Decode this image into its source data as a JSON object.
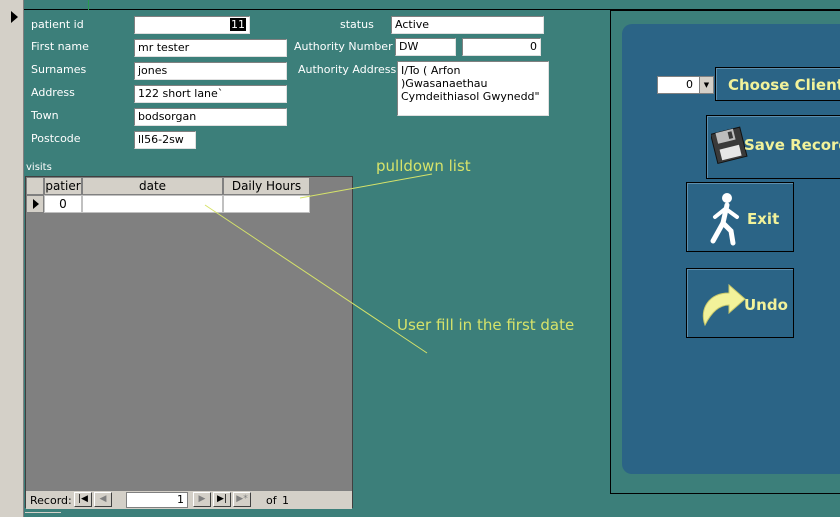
{
  "form": {
    "patient_id_label": "patient id",
    "patient_id_value": "11",
    "first_name_label": "First name",
    "first_name_value": "mr tester",
    "surnames_label": "Surnames",
    "surnames_value": "jones",
    "address_label": "Address",
    "address_value": "122 short lane`",
    "town_label": "Town",
    "town_value": "bodsorgan",
    "postcode_label": "Postcode",
    "postcode_value": "ll56-2sw",
    "status_label": "status",
    "status_value": "Active",
    "authority_number_label": "Authority Number",
    "authority_code_value": "DW",
    "authority_number_value": "0",
    "authority_address_label": "Authority Address1",
    "authority_address_line1": "I/To ( Arfon )Gwasanaethau",
    "authority_address_line2": "Cymdeithiasol Gwynedd\""
  },
  "visits": {
    "label": "visits",
    "columns": [
      "patier",
      "date",
      "Daily Hours"
    ],
    "rows": [
      {
        "patient": "0",
        "date": "",
        "daily_hours": ""
      }
    ],
    "nav": {
      "record_label": "Record:",
      "current": "1",
      "of_label": "of",
      "total": "1",
      "first_icon": "first-record-icon",
      "prev_icon": "previous-record-icon",
      "next_icon": "next-record-icon",
      "last_icon": "last-record-icon",
      "new_icon": "new-record-icon"
    }
  },
  "annotations": {
    "pulldown": "pulldown list",
    "user_fill": "User fill in the first date"
  },
  "colors": {
    "background": "#3c7f7a",
    "panel": "#2b6486",
    "button_text": "#f2f29a",
    "annotation": "#d6e36a"
  },
  "panel": {
    "client_combo_value": "0",
    "choose_client_label": "Choose Client",
    "save_record_label": "Save Record",
    "exit_label": "Exit",
    "undo_label": "Undo",
    "save_icon": "floppy-disk-icon",
    "exit_icon": "walking-man-icon",
    "undo_icon": "curved-arrow-icon"
  }
}
